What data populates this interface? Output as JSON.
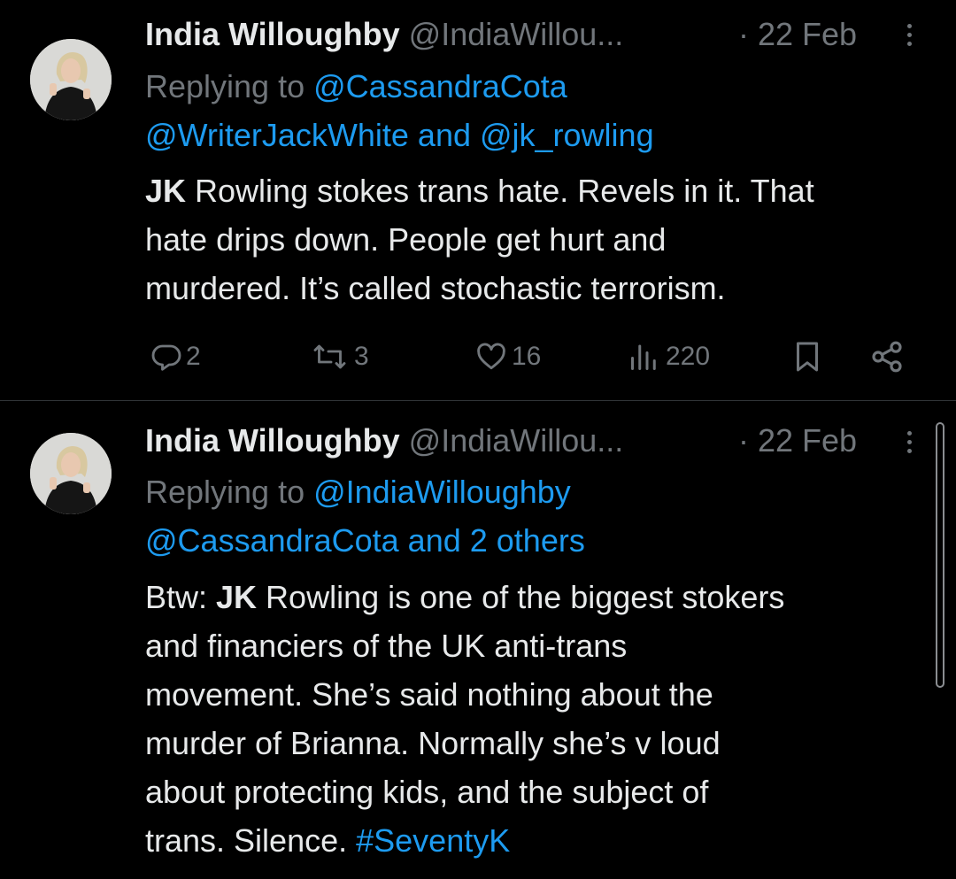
{
  "tweets": [
    {
      "author_name": "India Willoughby",
      "author_handle": "@IndiaWillou...",
      "dot": "·",
      "date": "22 Feb",
      "replying_prefix": "Replying to ",
      "replying_link1": "@CassandraCota",
      "replying_link2": "@WriterJackWhite and @jk_rowling",
      "body": {
        "jk": "JK",
        "line1_rest": " Rowling stokes trans hate. Revels in it. That",
        "line2": "hate drips down. People get hurt and",
        "line3": "murdered. It’s called stochastic terrorism."
      },
      "actions": {
        "replies": "2",
        "retweets": "3",
        "likes": "16",
        "views": "220"
      }
    },
    {
      "author_name": "India Willoughby",
      "author_handle": "@IndiaWillou...",
      "dot": "·",
      "date": "22 Feb",
      "replying_prefix": "Replying to ",
      "replying_link1": "@IndiaWilloughby",
      "replying_link2": "@CassandraCota and 2 others",
      "body": {
        "line1_prefix": "Btw: ",
        "jk": "JK",
        "line1_rest": " Rowling is one of the biggest stokers",
        "line2": "and financiers of the UK anti-trans",
        "line3": "movement. She’s said nothing about the",
        "line4": "murder of Brianna. Normally she’s v loud",
        "line5": "about protecting kids, and the subject of",
        "line6_text": "trans. Silence. ",
        "hashtag": "#SeventyK"
      }
    }
  ],
  "colors": {
    "background": "#000000",
    "text": "#e7e9ea",
    "muted": "#71767b",
    "link": "#1d9bf0",
    "divider": "#2f3336"
  },
  "icons": [
    "reply-icon",
    "retweet-icon",
    "like-icon",
    "views-icon",
    "bookmark-icon",
    "share-icon",
    "more-icon"
  ]
}
